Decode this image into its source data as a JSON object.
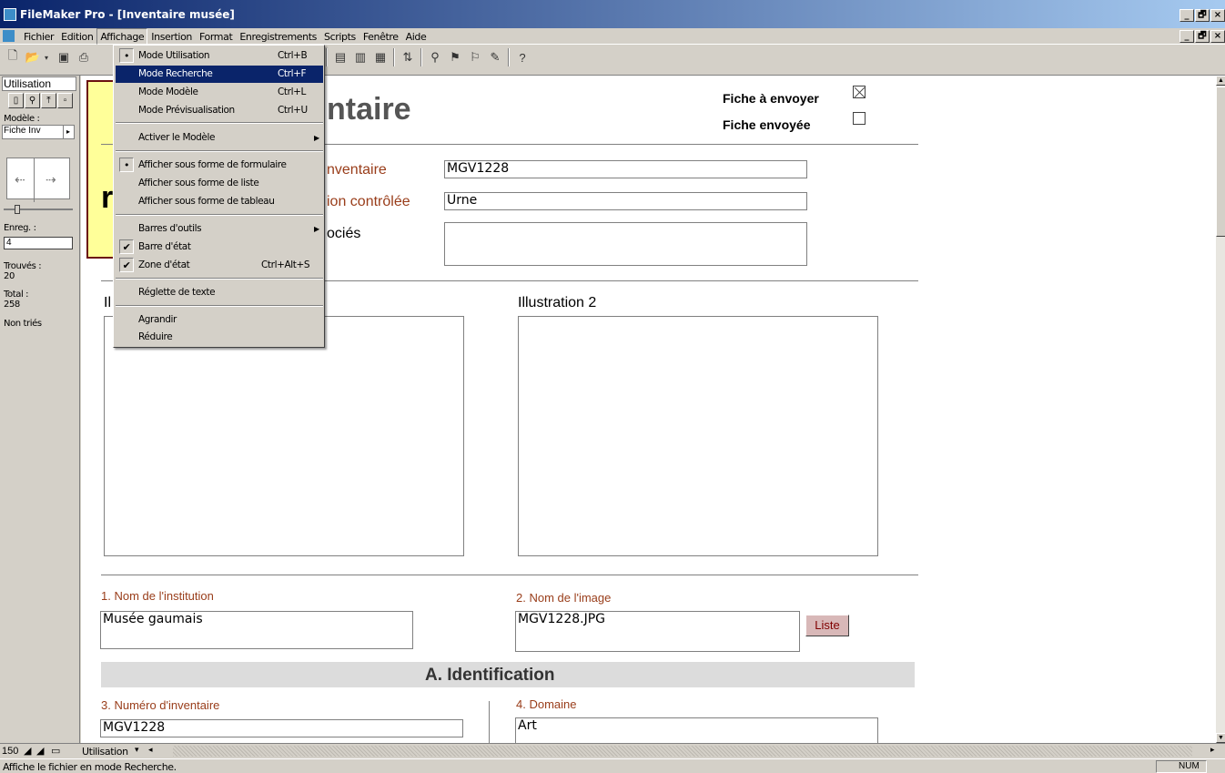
{
  "window": {
    "title": "FileMaker Pro - [Inventaire musée]",
    "buttons": [
      "_",
      "🗗",
      "×"
    ]
  },
  "menubar": {
    "items": [
      "Fichier",
      "Edition",
      "Affichage",
      "Insertion",
      "Format",
      "Enregistrements",
      "Scripts",
      "Fenêtre",
      "Aide"
    ],
    "open_item": "Affichage"
  },
  "dropdown": {
    "items": [
      {
        "label": "Mode Utilisation",
        "shortcut": "Ctrl+B",
        "mark": "•"
      },
      {
        "label": "Mode Recherche",
        "shortcut": "Ctrl+F",
        "highlighted": true
      },
      {
        "label": "Mode Modèle",
        "shortcut": "Ctrl+L"
      },
      {
        "label": "Mode Prévisualisation",
        "shortcut": "Ctrl+U"
      },
      {
        "label": "Activer le Modèle",
        "submenu": true
      },
      {
        "label": "Afficher sous forme de formulaire",
        "mark": "•"
      },
      {
        "label": "Afficher sous forme de liste"
      },
      {
        "label": "Afficher sous forme de tableau"
      },
      {
        "label": "Barres d'outils",
        "submenu": true
      },
      {
        "label": "Barre d'état",
        "mark": "✔"
      },
      {
        "label": "Zone d'état",
        "shortcut": "Ctrl+Alt+S",
        "mark": "✔"
      },
      {
        "label": "Réglette de texte"
      },
      {
        "label": "Agrandir"
      },
      {
        "label": "Réduire"
      }
    ]
  },
  "status_area": {
    "mode": "Utilisation",
    "layout_label": "Modèle :",
    "layout_value": "Fiche Inv",
    "record_label": "Enreg. :",
    "record_value": "4",
    "found_label": "Trouvés :",
    "found_value": "20",
    "total_label": "Total :",
    "total_value": "258",
    "sort_status": "Non triés"
  },
  "form": {
    "title_partial": "ntaire",
    "big_letter": "r",
    "fiche_a_envoyer": "Fiche à envoyer",
    "fiche_envoyee": "Fiche envoyée",
    "label_inventaire": "nventaire",
    "value_inventaire": "MGV1228",
    "label_controlee": "ion contrôlée",
    "value_controlee": "Urne",
    "label_associes": "ociés",
    "illustration1_partial": "Il",
    "illustration2": "Illustration 2",
    "institution_label": "1. Nom de l'institution",
    "institution_value": "Musée gaumais",
    "image_label": "2. Nom de l'image",
    "image_value": "MGV1228.JPG",
    "liste_button": "Liste",
    "section_title": "A. Identification",
    "num_inv_label": "3. Numéro d'inventaire",
    "num_inv_value": "MGV1228",
    "domaine_label": "4. Domaine",
    "domaine_value": "Art"
  },
  "bottom": {
    "zoom": "150",
    "mode": "Utilisation"
  },
  "statusbar": {
    "message": "Affiche le fichier en mode Recherche.",
    "num": "NUM"
  }
}
